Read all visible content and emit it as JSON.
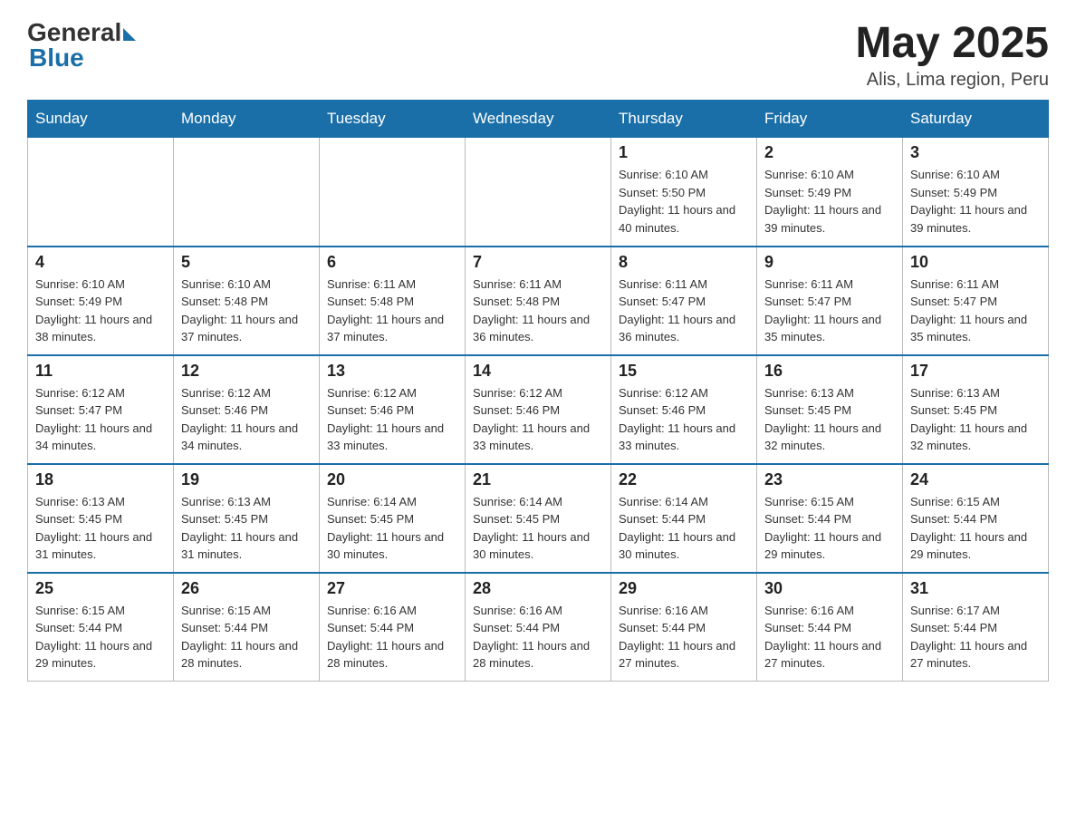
{
  "header": {
    "logo_text": "General Blue",
    "month_year": "May 2025",
    "location": "Alis, Lima region, Peru"
  },
  "days_of_week": [
    "Sunday",
    "Monday",
    "Tuesday",
    "Wednesday",
    "Thursday",
    "Friday",
    "Saturday"
  ],
  "weeks": [
    [
      {
        "day": "",
        "info": ""
      },
      {
        "day": "",
        "info": ""
      },
      {
        "day": "",
        "info": ""
      },
      {
        "day": "",
        "info": ""
      },
      {
        "day": "1",
        "info": "Sunrise: 6:10 AM\nSunset: 5:50 PM\nDaylight: 11 hours and 40 minutes."
      },
      {
        "day": "2",
        "info": "Sunrise: 6:10 AM\nSunset: 5:49 PM\nDaylight: 11 hours and 39 minutes."
      },
      {
        "day": "3",
        "info": "Sunrise: 6:10 AM\nSunset: 5:49 PM\nDaylight: 11 hours and 39 minutes."
      }
    ],
    [
      {
        "day": "4",
        "info": "Sunrise: 6:10 AM\nSunset: 5:49 PM\nDaylight: 11 hours and 38 minutes."
      },
      {
        "day": "5",
        "info": "Sunrise: 6:10 AM\nSunset: 5:48 PM\nDaylight: 11 hours and 37 minutes."
      },
      {
        "day": "6",
        "info": "Sunrise: 6:11 AM\nSunset: 5:48 PM\nDaylight: 11 hours and 37 minutes."
      },
      {
        "day": "7",
        "info": "Sunrise: 6:11 AM\nSunset: 5:48 PM\nDaylight: 11 hours and 36 minutes."
      },
      {
        "day": "8",
        "info": "Sunrise: 6:11 AM\nSunset: 5:47 PM\nDaylight: 11 hours and 36 minutes."
      },
      {
        "day": "9",
        "info": "Sunrise: 6:11 AM\nSunset: 5:47 PM\nDaylight: 11 hours and 35 minutes."
      },
      {
        "day": "10",
        "info": "Sunrise: 6:11 AM\nSunset: 5:47 PM\nDaylight: 11 hours and 35 minutes."
      }
    ],
    [
      {
        "day": "11",
        "info": "Sunrise: 6:12 AM\nSunset: 5:47 PM\nDaylight: 11 hours and 34 minutes."
      },
      {
        "day": "12",
        "info": "Sunrise: 6:12 AM\nSunset: 5:46 PM\nDaylight: 11 hours and 34 minutes."
      },
      {
        "day": "13",
        "info": "Sunrise: 6:12 AM\nSunset: 5:46 PM\nDaylight: 11 hours and 33 minutes."
      },
      {
        "day": "14",
        "info": "Sunrise: 6:12 AM\nSunset: 5:46 PM\nDaylight: 11 hours and 33 minutes."
      },
      {
        "day": "15",
        "info": "Sunrise: 6:12 AM\nSunset: 5:46 PM\nDaylight: 11 hours and 33 minutes."
      },
      {
        "day": "16",
        "info": "Sunrise: 6:13 AM\nSunset: 5:45 PM\nDaylight: 11 hours and 32 minutes."
      },
      {
        "day": "17",
        "info": "Sunrise: 6:13 AM\nSunset: 5:45 PM\nDaylight: 11 hours and 32 minutes."
      }
    ],
    [
      {
        "day": "18",
        "info": "Sunrise: 6:13 AM\nSunset: 5:45 PM\nDaylight: 11 hours and 31 minutes."
      },
      {
        "day": "19",
        "info": "Sunrise: 6:13 AM\nSunset: 5:45 PM\nDaylight: 11 hours and 31 minutes."
      },
      {
        "day": "20",
        "info": "Sunrise: 6:14 AM\nSunset: 5:45 PM\nDaylight: 11 hours and 30 minutes."
      },
      {
        "day": "21",
        "info": "Sunrise: 6:14 AM\nSunset: 5:45 PM\nDaylight: 11 hours and 30 minutes."
      },
      {
        "day": "22",
        "info": "Sunrise: 6:14 AM\nSunset: 5:44 PM\nDaylight: 11 hours and 30 minutes."
      },
      {
        "day": "23",
        "info": "Sunrise: 6:15 AM\nSunset: 5:44 PM\nDaylight: 11 hours and 29 minutes."
      },
      {
        "day": "24",
        "info": "Sunrise: 6:15 AM\nSunset: 5:44 PM\nDaylight: 11 hours and 29 minutes."
      }
    ],
    [
      {
        "day": "25",
        "info": "Sunrise: 6:15 AM\nSunset: 5:44 PM\nDaylight: 11 hours and 29 minutes."
      },
      {
        "day": "26",
        "info": "Sunrise: 6:15 AM\nSunset: 5:44 PM\nDaylight: 11 hours and 28 minutes."
      },
      {
        "day": "27",
        "info": "Sunrise: 6:16 AM\nSunset: 5:44 PM\nDaylight: 11 hours and 28 minutes."
      },
      {
        "day": "28",
        "info": "Sunrise: 6:16 AM\nSunset: 5:44 PM\nDaylight: 11 hours and 28 minutes."
      },
      {
        "day": "29",
        "info": "Sunrise: 6:16 AM\nSunset: 5:44 PM\nDaylight: 11 hours and 27 minutes."
      },
      {
        "day": "30",
        "info": "Sunrise: 6:16 AM\nSunset: 5:44 PM\nDaylight: 11 hours and 27 minutes."
      },
      {
        "day": "31",
        "info": "Sunrise: 6:17 AM\nSunset: 5:44 PM\nDaylight: 11 hours and 27 minutes."
      }
    ]
  ]
}
